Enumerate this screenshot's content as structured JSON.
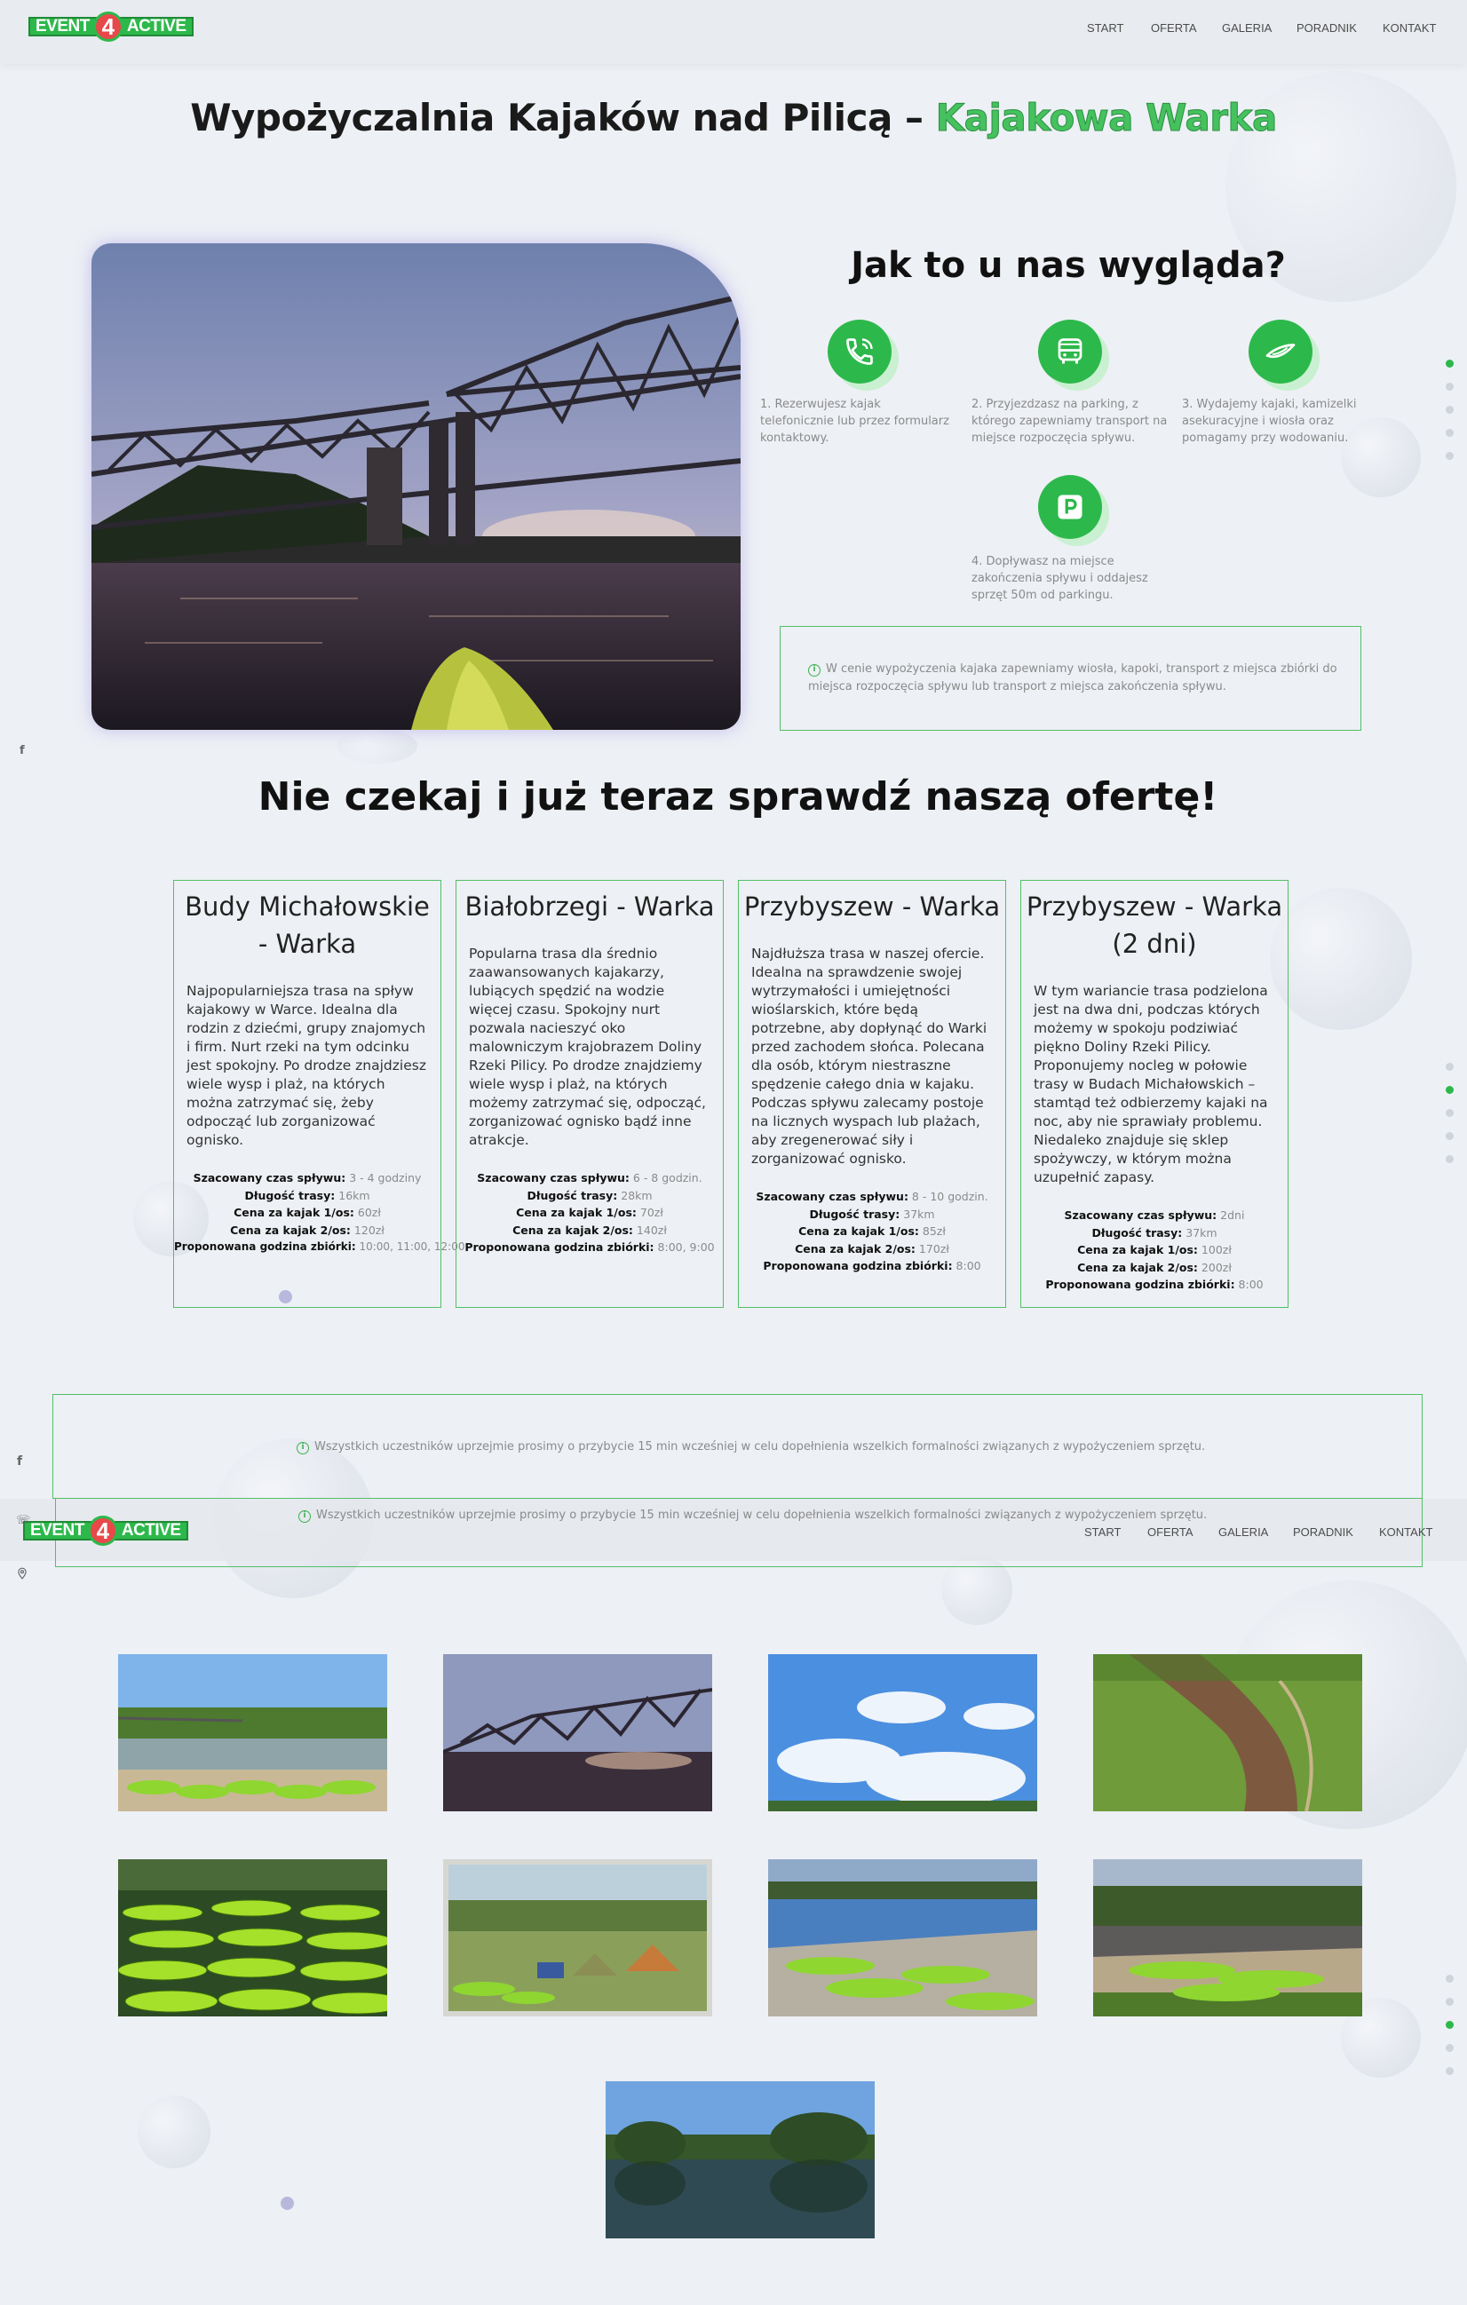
{
  "brand": {
    "left": "EVENT",
    "num": "4",
    "right": "ACTIVE"
  },
  "nav": {
    "items": [
      "START",
      "OFERTA",
      "GALERIA",
      "PORADNIK",
      "KONTAKT"
    ]
  },
  "page_title": {
    "main": "Wypożyczalnia Kajaków nad Pilicą – ",
    "accent": "Kajakowa Warka"
  },
  "how": {
    "title": "Jak to u nas wygląda?",
    "steps": [
      {
        "icon": "phone-icon",
        "text": "1. Rezerwujesz kajak telefonicznie lub przez formularz kontaktowy."
      },
      {
        "icon": "bus-icon",
        "text": "2. Przyjezdzasz na parking, z którego zapewniamy transport na miejsce rozpoczęcia spływu."
      },
      {
        "icon": "kayak-icon",
        "text": "3. Wydajemy kajaki, kamizelki asekuracyjne i wiosła oraz pomagamy przy wodowaniu."
      },
      {
        "icon": "parking-icon",
        "text": "4. Dopływasz na miejsce zakończenia spływu i oddajesz sprzęt 50m od parkingu."
      }
    ],
    "info": "W cenie wypożyczenia kajaka zapewniamy wiosła, kapoki, transport z miejsca zbiórki do miejsca rozpoczęcia spływu lub transport z miejsca zakończenia spływu."
  },
  "offer": {
    "title": "Nie czekaj i już teraz sprawdź naszą ofertę!",
    "labels": {
      "time": "Szacowany czas spływu:",
      "length": "Długość trasy:",
      "price1": "Cena za kajak 1/os:",
      "price2": "Cena za kajak 2/os:",
      "meet": "Proponowana godzina zbiórki:"
    },
    "cards": [
      {
        "title": "Budy Michałowskie - Warka",
        "desc": "Najpopularniejsza trasa na spływ kajakowy w Warce. Idealna dla rodzin z dziećmi, grupy znajomych i firm. Nurt rzeki na tym odcinku jest spokojny. Po drodze znajdziesz wiele wysp i plaż, na których można zatrzymać się, żeby odpocząć lub zorganizować ognisko.",
        "time": " 3 - 4 godziny",
        "length": " 16km",
        "price1": " 60zł",
        "price2": " 120zł",
        "meet": " 10:00, 11:00, 12:00"
      },
      {
        "title": "Białobrzegi - Warka",
        "desc": "Popularna trasa dla średnio zaawansowanych kajakarzy, lubiących spędzić na wodzie więcej czasu. Spokojny nurt pozwala nacieszyć oko malowniczym krajobrazem Doliny Rzeki Pilicy. Po drodze znajdziemy wiele wysp i plaż, na których możemy zatrzymać się, odpocząć, zorganizować ognisko bądź inne atrakcje.",
        "time": " 6 - 8 godzin.",
        "length": " 28km",
        "price1": " 70zł",
        "price2": " 140zł",
        "meet": " 8:00, 9:00"
      },
      {
        "title": "Przybyszew - Warka",
        "desc": "Najdłuższa trasa w naszej ofercie. Idealna na sprawdzenie swojej wytrzymałości i umiejętności wioślarskich, które będą potrzebne, aby dopłynąć do Warki przed zachodem słońca. Polecana dla osób, którym niestraszne spędzenie całego dnia w kajaku. Podczas spływu zalecamy postoje na licznych wyspach lub plażach, aby zregenerować siły i zorganizować ognisko.",
        "time": " 8 - 10 godzin.",
        "length": " 37km",
        "price1": " 85zł",
        "price2": " 170zł",
        "meet": " 8:00"
      },
      {
        "title": "Przybyszew - Warka (2 dni)",
        "desc": "W tym wariancie trasa podzielona jest na dwa dni, podczas których możemy w spokoju podziwiać piękno Doliny Rzeki Pilicy. Proponujemy nocleg w połowie trasy w Budach Michałowskich – stamtąd też odbierzemy kajaki na noc, aby nie sprawiały problemu. Niedaleko znajduje się sklep spożywczy, w którym można uzupełnić zapasy.",
        "time": " 2dni",
        "length": " 37km",
        "price1": " 100zł",
        "price2": " 200zł",
        "meet": " 8:00"
      }
    ]
  },
  "notice": "Wszystkich uczestników uprzejmie prosimy o przybycie 15 min wcześniej w celu dopełnienia wszelkich formalności związanych z wypożyczeniem sprzętu.",
  "gallery": {
    "count": 9
  }
}
